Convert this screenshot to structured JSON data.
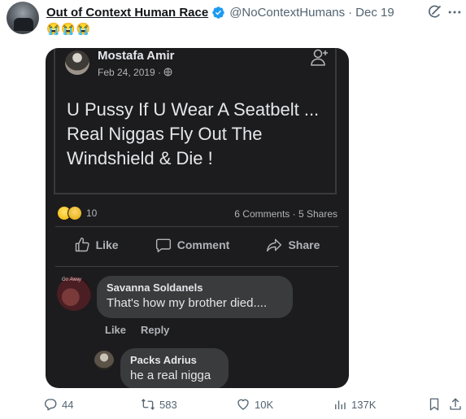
{
  "tweet": {
    "author": "Out of Context Human Race",
    "handle": "@NoContextHumans",
    "separator": "·",
    "date": "Dec 19",
    "text_emojis": "😭😭😭",
    "icons": [
      "verified-badge-icon",
      "grok-icon",
      "more-icon"
    ],
    "accent_color": "#1d9bf0"
  },
  "embedded_post": {
    "author": "Mostafa Amir",
    "date": "Feb 24, 2019 · ",
    "privacy_icon": "globe-icon",
    "text": "U Pussy If U Wear A Seatbelt ... Real Niggas Fly Out The Windshield & Die !",
    "reaction_count": "10",
    "comments_shares": "6 Comments · 5 Shares",
    "actions": {
      "like": "Like",
      "comment": "Comment",
      "share": "Share"
    },
    "comments": [
      {
        "name": "Savanna Soldanels",
        "text": "That's how my brother died....",
        "avatar_label": "Go Away"
      },
      {
        "name": "Packs Adrius",
        "text": "he a real nigga"
      }
    ],
    "comment_actions": {
      "like": "Like",
      "reply": "Reply"
    }
  },
  "tweet_actions": {
    "replies": "44",
    "retweets": "583",
    "likes": "10K",
    "views": "137K"
  }
}
